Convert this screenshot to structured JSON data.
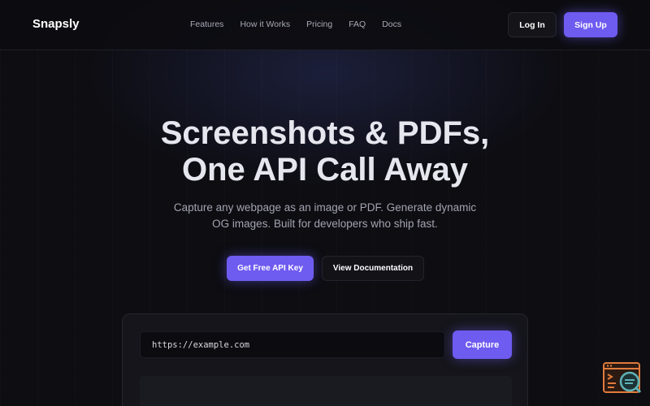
{
  "header": {
    "logo": "Snapsly",
    "nav": [
      {
        "label": "Features"
      },
      {
        "label": "How it Works"
      },
      {
        "label": "Pricing"
      },
      {
        "label": "FAQ"
      },
      {
        "label": "Docs"
      }
    ],
    "login_label": "Log In",
    "signup_label": "Sign Up"
  },
  "hero": {
    "title_line1": "Screenshots & PDFs,",
    "title_line2": "One API Call Away",
    "subtitle_line1": "Capture any webpage as an image or PDF. Generate dynamic",
    "subtitle_line2": "OG images. Built for developers who ship fast.",
    "cta_primary": "Get Free API Key",
    "cta_secondary": "View Documentation"
  },
  "demo": {
    "url_value": "https://example.com",
    "capture_label": "Capture"
  },
  "widget": {
    "icon": "code-search-icon"
  },
  "colors": {
    "accent": "#6e5bf0",
    "background": "#0d0d12",
    "widget_orange": "#e07a3c",
    "widget_teal": "#5fb3b8"
  }
}
